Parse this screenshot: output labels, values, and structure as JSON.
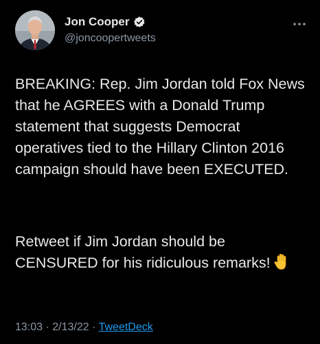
{
  "author": {
    "display_name": "Jon Cooper",
    "handle": "@joncoopertweets",
    "verified": true,
    "avatar": "avatar-photo"
  },
  "tweet": {
    "paragraph_1": "BREAKING: Rep. Jim Jordan told Fox News that he AGREES with a Donald Trump statement that suggests Democrat operatives tied to the Hillary Clinton 2016 campaign should have been EXECUTED.",
    "paragraph_2": "Retweet if Jim Jordan should be CENSURED for his ridiculous remarks!",
    "emoji": "raised-hand-icon"
  },
  "meta": {
    "time": "13:03",
    "separator": " · ",
    "date": "2/13/22",
    "separator2": " · ",
    "source": "TweetDeck"
  },
  "icons": {
    "verified": "verified-badge-icon",
    "more": "more-options-icon"
  },
  "colors": {
    "background": "#000000",
    "text": "#e7e9ea",
    "secondary": "#8b98a5",
    "link": "#1d9bf0"
  }
}
